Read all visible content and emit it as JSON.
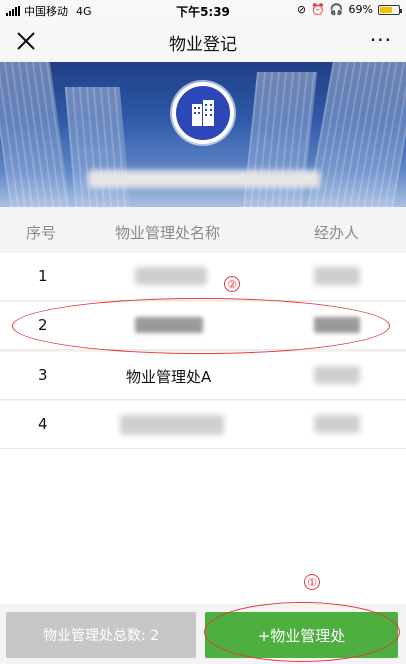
{
  "status_bar": {
    "carrier": "中国移动",
    "network": "4G",
    "time": "下午5:39",
    "battery": "69%",
    "battery_level": 0.69
  },
  "nav": {
    "title": "物业登记",
    "more": "···"
  },
  "banner": {
    "logo_icon": "building-icon"
  },
  "table": {
    "headers": {
      "no": "序号",
      "name": "物业管理处名称",
      "agent": "经办人"
    },
    "rows": [
      {
        "no": "1",
        "name": ""
      },
      {
        "no": "2",
        "name": ""
      },
      {
        "no": "3",
        "name": "物业管理处A"
      },
      {
        "no": "4",
        "name": ""
      }
    ]
  },
  "bottom": {
    "total_label": "物业管理处总数: 2",
    "add_label": "+物业管理处"
  },
  "annotations": {
    "mark_1": "①",
    "mark_2": "②"
  },
  "colors": {
    "accent_green": "#4caf3f",
    "annotation_red": "#e23a3a",
    "banner_blue": "#2f5aa8"
  }
}
